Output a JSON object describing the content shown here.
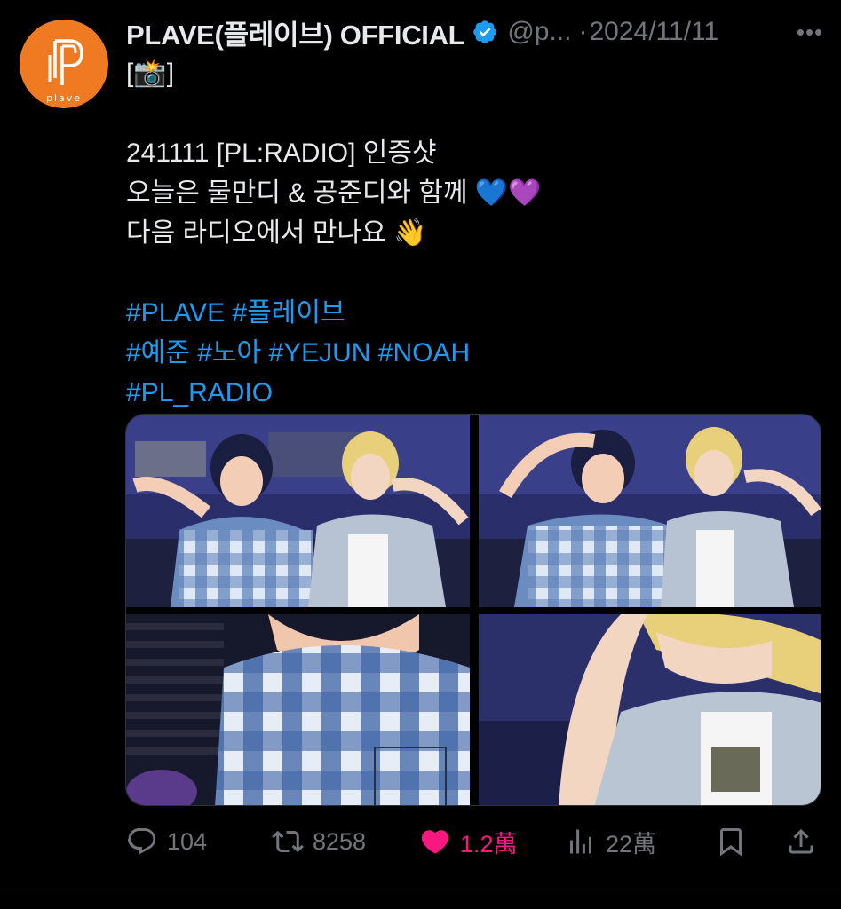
{
  "tweet": {
    "avatar": {
      "brand_color": "#f07a22",
      "logo_text": "plave"
    },
    "author": {
      "display_name": "PLAVE(플레이브) OFFICIAL",
      "verified_icon": "verified-badge-icon",
      "handle": "@p...",
      "separator": "·",
      "date": "2024/11/11"
    },
    "more_icon": "more-horizontal-icon",
    "more_label": "•••",
    "text_lines": [
      {
        "text": "[📸]"
      },
      {
        "text": ""
      },
      {
        "text": "241111 [PL:RADIO] 인증샷"
      },
      {
        "text": "오늘은 물만디 & 공준디와 함께 💙💜"
      },
      {
        "text": "다음 라디오에서 만나요 👋"
      },
      {
        "text": ""
      },
      {
        "text": "#PLAVE #플레이브",
        "hashtag": true
      },
      {
        "text": "#예준 #노아 #YEJUN #NOAH",
        "hashtag": true
      },
      {
        "text": "#PL_RADIO",
        "hashtag": true
      }
    ],
    "media": [
      {
        "name": "photo-1",
        "alt": "Two animated characters posing with peace signs in a radio studio"
      },
      {
        "name": "photo-2",
        "alt": "Two animated characters, one with hand on head"
      },
      {
        "name": "photo-3",
        "alt": "Close-up of blue plaid shirt"
      },
      {
        "name": "photo-4",
        "alt": "Close-up of blond character in plaid shirt"
      }
    ],
    "actions": {
      "reply": {
        "icon": "reply-icon",
        "count": "104"
      },
      "retweet": {
        "icon": "retweet-icon",
        "count": "8258"
      },
      "like": {
        "icon": "heart-filled-icon",
        "count": "1.2萬",
        "color": "#f91880",
        "liked": true
      },
      "views": {
        "icon": "views-bar-chart-icon",
        "count": "22萬"
      },
      "bookmark": {
        "icon": "bookmark-icon"
      },
      "share": {
        "icon": "share-upload-icon"
      }
    },
    "colors": {
      "background": "#000000",
      "text": "#e7e9ea",
      "muted": "#71767b",
      "link": "#1d9bf0",
      "verified": "#1d9bf0"
    }
  }
}
